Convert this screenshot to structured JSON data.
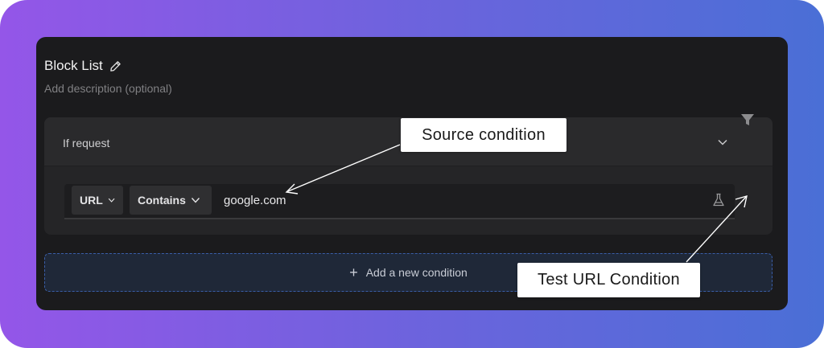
{
  "header": {
    "title": "Block List",
    "description_placeholder": "Add description (optional)"
  },
  "rule": {
    "if_label": "If request",
    "condition": {
      "source": "URL",
      "operator": "Contains",
      "value": "google.com"
    },
    "add_condition_label": "Add a new condition"
  },
  "annotations": {
    "source_condition": "Source condition",
    "test_url_condition": "Test URL Condition"
  },
  "colors": {
    "gradient_start": "#9456e8",
    "gradient_end": "#4a6fd6",
    "panel": "#1b1b1d",
    "add_border": "#3a5ea8"
  }
}
